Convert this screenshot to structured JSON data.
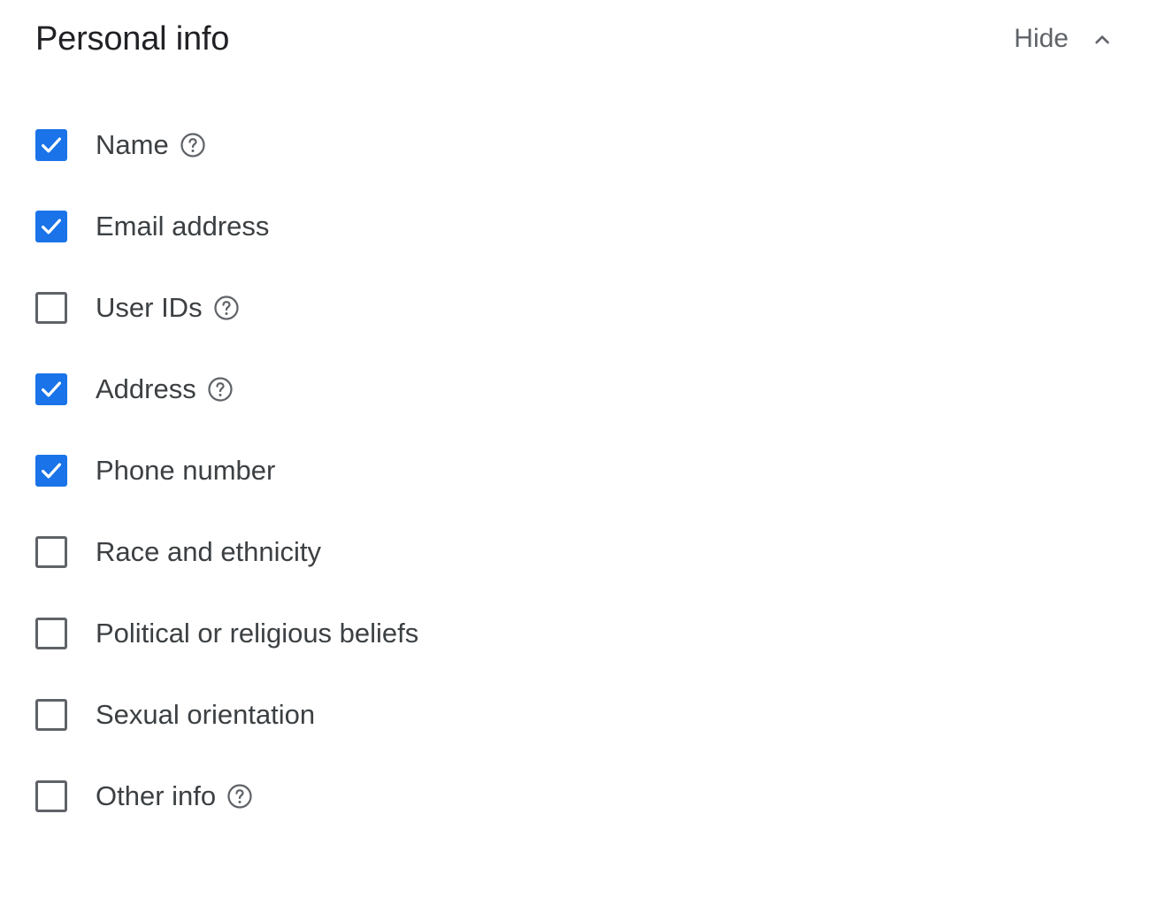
{
  "section": {
    "title": "Personal info",
    "toggle_label": "Hide",
    "toggle_icon": "chevron-up-icon"
  },
  "items": [
    {
      "label": "Name",
      "checked": true,
      "help": true
    },
    {
      "label": "Email address",
      "checked": true,
      "help": false
    },
    {
      "label": "User IDs",
      "checked": false,
      "help": true
    },
    {
      "label": "Address",
      "checked": true,
      "help": true
    },
    {
      "label": "Phone number",
      "checked": true,
      "help": false
    },
    {
      "label": "Race and ethnicity",
      "checked": false,
      "help": false
    },
    {
      "label": "Political or religious beliefs",
      "checked": false,
      "help": false
    },
    {
      "label": "Sexual orientation",
      "checked": false,
      "help": false
    },
    {
      "label": "Other info",
      "checked": false,
      "help": true
    }
  ],
  "colors": {
    "checked": "#1a73e8",
    "unchecked_border": "#5f6368",
    "text": "#3c4043",
    "title": "#202124",
    "muted": "#5f6368"
  }
}
